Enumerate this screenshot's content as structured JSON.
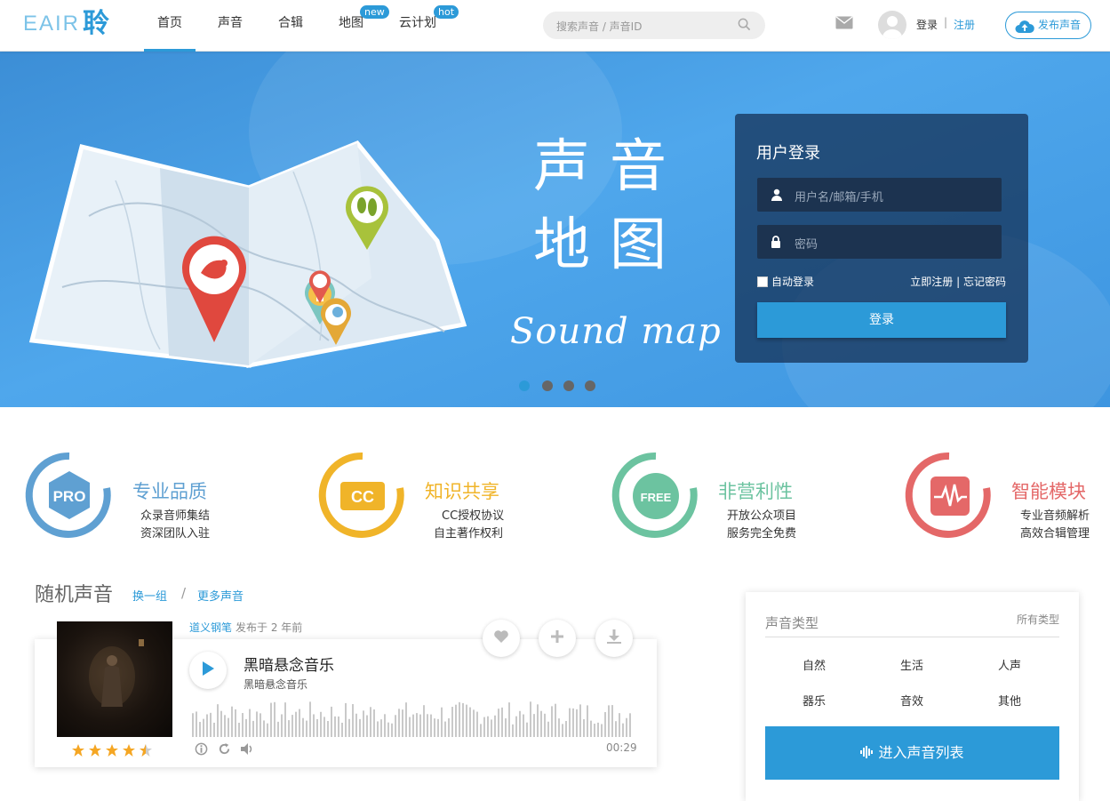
{
  "header": {
    "logo_text": "EAIR",
    "logo_char": "聆",
    "nav": [
      {
        "label": "首页"
      },
      {
        "label": "声音"
      },
      {
        "label": "合辑"
      },
      {
        "label": "地图",
        "badge": "new"
      },
      {
        "label": "云计划",
        "badge": "hot"
      }
    ],
    "search_placeholder": "搜索声音 / 声音ID",
    "login": "登录",
    "separator": "|",
    "register": "注册",
    "publish": "发布声音"
  },
  "banner": {
    "title_chars": [
      "声",
      "音",
      "地",
      "图"
    ],
    "subtitle": "Sound map",
    "login_box": {
      "title": "用户登录",
      "username_placeholder": "用户名/邮箱/手机",
      "password_placeholder": "密码",
      "auto_login": "自动登录",
      "register_now": "立即注册",
      "link_separator": "|",
      "forgot_password": "忘记密码",
      "submit": "登录"
    },
    "carousel_total": 4,
    "carousel_active": 1
  },
  "features": [
    {
      "badge": "PRO",
      "title": "专业品质",
      "line1": "众录音师集结",
      "line2": "资深团队入驻",
      "color": "#5fa0d2"
    },
    {
      "badge": "CC",
      "title": "知识共享",
      "line1": "CC授权协议",
      "line2": "自主著作权利",
      "color": "#f0b429"
    },
    {
      "badge": "FREE",
      "title": "非营利性",
      "line1": "开放公众项目",
      "line2": "服务完全免费",
      "color": "#6cc3a0"
    },
    {
      "badge": "wave",
      "title": "智能模块",
      "line1": "专业音频解析",
      "line2": "高效合辑管理",
      "color": "#e46868"
    }
  ],
  "random": {
    "title": "随机声音",
    "swap": "换一组",
    "divider": "/",
    "more": "更多声音",
    "sound": {
      "author": "道义钢笔",
      "meta": "发布于 2 年前",
      "title": "黑暗悬念音乐",
      "subtitle": "黑暗悬念音乐",
      "duration": "00:29",
      "rating": 4.5
    }
  },
  "types": {
    "title": "声音类型",
    "all": "所有类型",
    "items": [
      "自然",
      "生活",
      "人声",
      "器乐",
      "音效",
      "其他"
    ],
    "enter": "进入声音列表"
  },
  "colors": {
    "accent": "#2c9ad8"
  }
}
